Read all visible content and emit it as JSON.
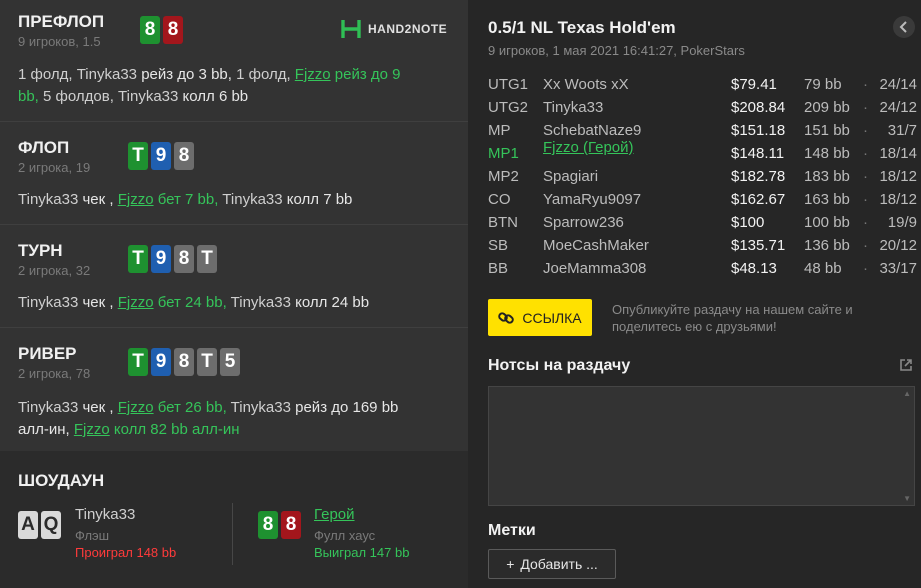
{
  "logo": {
    "text": "HAND2NOTE"
  },
  "streets": {
    "preflop": {
      "title": "ПРЕФЛОП",
      "sub": "9 игроков, 1.5",
      "cards": [
        "8",
        "8"
      ],
      "actions": {
        "a1": "1 фолд, Tinyka33 ",
        "a2": "рейз до 3 bb,",
        "a3": " 1 фолд, ",
        "hero": "Fjzzo",
        "a4": " рейз до 9",
        "a5": "bb,",
        "a6": " 5 фолдов, Tinyka33 ",
        "a7": "колл 6 bb"
      }
    },
    "flop": {
      "title": "ФЛОП",
      "sub": "2 игрока, 19",
      "cards": [
        "T",
        "9",
        "8"
      ],
      "actions": {
        "a1": "Tinyka33 ",
        "a2": "чек ,",
        "a3": " ",
        "hero": "Fjzzo",
        "a4": " бет 7 bb,",
        "a5": " Tinyka33 ",
        "a6": "колл 7 bb"
      }
    },
    "turn": {
      "title": "ТУРН",
      "sub": "2 игрока, 32",
      "cards": [
        "T",
        "9",
        "8",
        "T"
      ],
      "actions": {
        "a1": "Tinyka33 ",
        "a2": "чек ,",
        "a3": " ",
        "hero": "Fjzzo",
        "a4": " бет 24 bb,",
        "a5": " Tinyka33 ",
        "a6": "колл 24 bb"
      }
    },
    "river": {
      "title": "РИВЕР",
      "sub": "2 игрока, 78",
      "cards": [
        "T",
        "9",
        "8",
        "T",
        "5"
      ],
      "actions": {
        "a1": "Tinyka33 ",
        "a2": "чек ,",
        "a3": " ",
        "hero": "Fjzzo",
        "a4": " бет 26 bb,",
        "a5": " Tinyka33 ",
        "a6": "рейз до 169 bb",
        "a7": "алл-ин,",
        "a8": " ",
        "hero2": "Fjzzo",
        "a9": " колл 82 bb алл-ин"
      }
    }
  },
  "showdown": {
    "title": "ШОУДАУН",
    "villain": {
      "cards": [
        "A",
        "Q"
      ],
      "name": "Tinyka33",
      "hand": "Флэш",
      "result": "Проиграл 148 bb"
    },
    "hero": {
      "cards": [
        "8",
        "8"
      ],
      "name": "Герой",
      "hand": "Фулл хаус",
      "result": "Выиграл 147 bb"
    }
  },
  "hand": {
    "title": "0.5/1 NL Texas Hold'em",
    "sub": "9 игроков, 1 мая 2021 16:41:27, PokerStars",
    "back_icon": "chevron-left-icon"
  },
  "players": [
    {
      "pos": "UTG1",
      "name": "Xx Woots xX",
      "stack": "$79.41",
      "bb": "79 bb",
      "dot": "·",
      "record": "24/14"
    },
    {
      "pos": "UTG2",
      "name": "Tinyka33",
      "stack": "$208.84",
      "bb": "209 bb",
      "dot": "·",
      "record": "24/12"
    },
    {
      "pos": "MP",
      "name": "SchebatNaze9",
      "stack": "$151.18",
      "bb": "151 bb",
      "dot": "·",
      "record": "31/7"
    },
    {
      "pos": "MP1",
      "name": "Fjzzo (Герой)",
      "stack": "$148.11",
      "bb": "148 bb",
      "dot": "·",
      "record": "18/14"
    },
    {
      "pos": "MP2",
      "name": "Spagiari",
      "stack": "$182.78",
      "bb": "183 bb",
      "dot": "·",
      "record": "18/12"
    },
    {
      "pos": "CO",
      "name": "YamaRyu9097",
      "stack": "$162.67",
      "bb": "163 bb",
      "dot": "·",
      "record": "18/12"
    },
    {
      "pos": "BTN",
      "name": "Sparrow236",
      "stack": "$100",
      "bb": "100 bb",
      "dot": "·",
      "record": "19/9"
    },
    {
      "pos": "SB",
      "name": "MoeCashMaker",
      "stack": "$135.71",
      "bb": "136 bb",
      "dot": "·",
      "record": "20/12"
    },
    {
      "pos": "BB",
      "name": "JoeMamma308",
      "stack": "$48.13",
      "bb": "48 bb",
      "dot": "·",
      "record": "33/17"
    }
  ],
  "share": {
    "button_label": "ССЫЛКА",
    "text": "Опубликуйте раздачу на нашем сайте и поделитесь ею с друзьями!"
  },
  "notes": {
    "title": "Нотсы на раздачу",
    "value": ""
  },
  "tags": {
    "title": "Метки",
    "add_label": "Добавить ...",
    "add_prefix": "+"
  },
  "colors": {
    "hero": "#35c45a",
    "link_button": "#ffe100",
    "loss": "#ff3b3b",
    "card_green": "#1e9130",
    "card_red": "#a3161c",
    "card_blue": "#1f5fb0",
    "card_gray": "#6d6d6d"
  }
}
